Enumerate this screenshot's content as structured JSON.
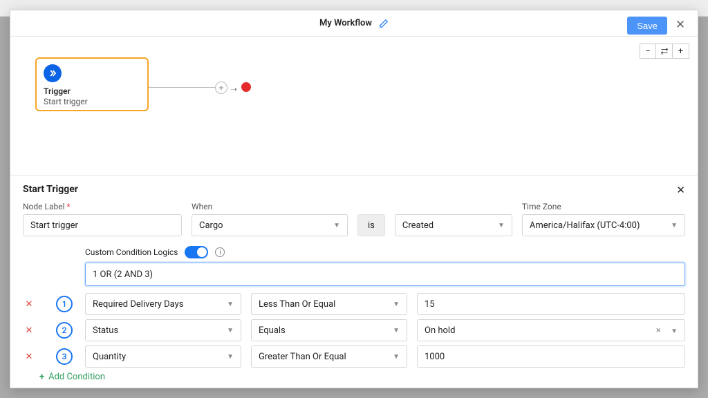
{
  "header": {
    "title": "My Workflow",
    "save": "Save"
  },
  "canvas": {
    "node": {
      "title": "Trigger",
      "subtitle": "Start trigger"
    }
  },
  "config": {
    "title": "Start Trigger",
    "labels": {
      "node_label": "Node Label",
      "when": "When",
      "timezone": "Time Zone",
      "custom_logic": "Custom Condition Logics",
      "add_condition": "Add Condition",
      "is": "is"
    },
    "values": {
      "node_label": "Start trigger",
      "when": "Cargo",
      "event": "Created",
      "timezone": "America/Halifax (UTC-4:00)",
      "logic_expr": "1 OR (2 AND 3)"
    },
    "conditions": [
      {
        "n": "1",
        "field": "Required Delivery Days",
        "op": "Less Than Or Equal",
        "value": "15",
        "clearable": false
      },
      {
        "n": "2",
        "field": "Status",
        "op": "Equals",
        "value": "On hold",
        "clearable": true
      },
      {
        "n": "3",
        "field": "Quantity",
        "op": "Greater Than Or Equal",
        "value": "1000",
        "clearable": false
      }
    ]
  }
}
